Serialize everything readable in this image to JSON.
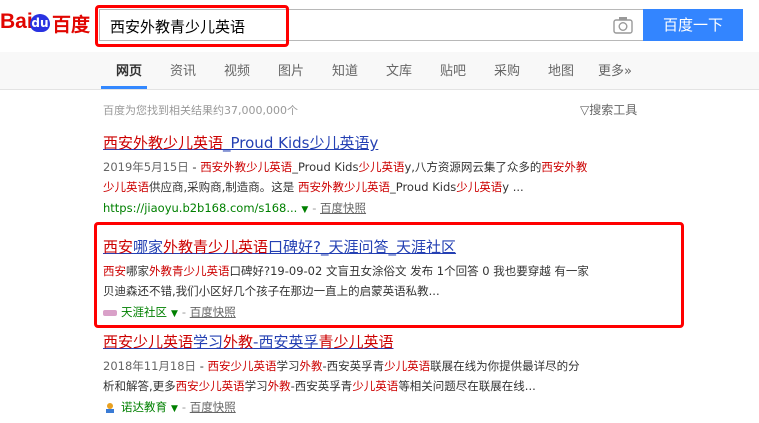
{
  "header": {
    "logo": {
      "bai": "Bai",
      "du": "du",
      "zh": "百度"
    },
    "search_query": "西安外教青少儿英语",
    "search_button": "百度一下"
  },
  "tabs": [
    {
      "label": "网页"
    },
    {
      "label": "资讯"
    },
    {
      "label": "视频"
    },
    {
      "label": "图片"
    },
    {
      "label": "知道"
    },
    {
      "label": "文库"
    },
    {
      "label": "贴吧"
    },
    {
      "label": "采购"
    },
    {
      "label": "地图"
    },
    {
      "label": "更多»"
    }
  ],
  "result_count": "百度为您找到相关结果约37,000,000个",
  "search_tools": "搜索工具",
  "results": [
    {
      "title_parts": [
        "西安外教少儿英语",
        "_Proud Kids少儿英语y"
      ],
      "date": "2019年5月15日",
      "snippet_line1": [
        "西安外教少儿英语",
        "_Proud Kids",
        "少儿英语",
        "y,八方资源网云集了众多的",
        "西安外教"
      ],
      "snippet_line2": [
        "少儿英语",
        "供应商,采购商,制造商。这是 ",
        "西安外教少儿英语",
        "_Proud Kids",
        "少儿英语",
        "y ..."
      ],
      "url": "https://jiaoyu.b2b168.com/s168...",
      "cache": "百度快照"
    },
    {
      "title_parts": [
        "西安",
        "哪家",
        "外教青少儿英语",
        "口碑好?_天涯问答_天涯社区"
      ],
      "snippet_line1": [
        "西安",
        "哪家",
        "外教青少儿英语",
        "口碑好?19-09-02 文盲丑女涂俗文 发布 1个回答 0 我也要穿越 有一家"
      ],
      "snippet_line2": [
        "贝迪森还不错,我们小区好几个孩子在那边一直上的启蒙英语私教..."
      ],
      "source": "天涯社区",
      "cache": "百度快照"
    },
    {
      "title_parts": [
        "西安少儿英语",
        "学习",
        "外教",
        "-西安英孚",
        "青少儿英语"
      ],
      "date": "2018年11月18日",
      "snippet_line1": [
        "西安少儿英语",
        "学习",
        "外教",
        "-西安英孚青",
        "少儿英语",
        "联展在线为你提供最详尽的分"
      ],
      "snippet_line2": [
        "析和解答,更多",
        "西安少儿英语",
        "学习",
        "外教",
        "-西安英孚青",
        "少儿英语",
        "等相关问题尽在联展在线..."
      ],
      "source": "诺达教育",
      "cache": "百度快照"
    }
  ],
  "colors": {
    "accent": "#3385ff",
    "link": "#2440b3",
    "highlight": "#cc0000",
    "annotation": "#ff0000"
  }
}
